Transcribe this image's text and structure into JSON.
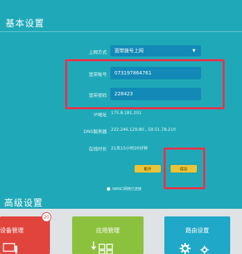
{
  "basic_settings": {
    "title": "基本设置",
    "rows": {
      "connection_type": {
        "label": "上网方式",
        "value": "宽带拨号上网"
      },
      "account": {
        "label": "宽带账号",
        "value": "073197864761"
      },
      "password": {
        "label": "宽带密码",
        "value": "228423"
      },
      "ip_address": {
        "label": "IP地址",
        "value": "175.8.181.201"
      },
      "dns_server": {
        "label": "DNS服务器",
        "value": "222.246.129.80 , 59.51.78.210"
      },
      "online_time": {
        "label": "在线时长",
        "value": "21天15小时20分钟"
      }
    },
    "buttons": {
      "disconnect": "断开",
      "save": "保存"
    },
    "status": "WAN口网络已连接"
  },
  "advanced_settings": {
    "title": "高级设置",
    "tiles": [
      {
        "label": "设备管理",
        "badge": "20",
        "color": "#e0443c"
      },
      {
        "label": "应用管理",
        "color": "#8cc13d"
      },
      {
        "label": "路由设置",
        "color": "#1fa8c8"
      }
    ]
  },
  "colors": {
    "background": "#1fa9b8",
    "field": "#1289b6",
    "highlight_box": "#e8334a",
    "button": "#e9c338"
  }
}
